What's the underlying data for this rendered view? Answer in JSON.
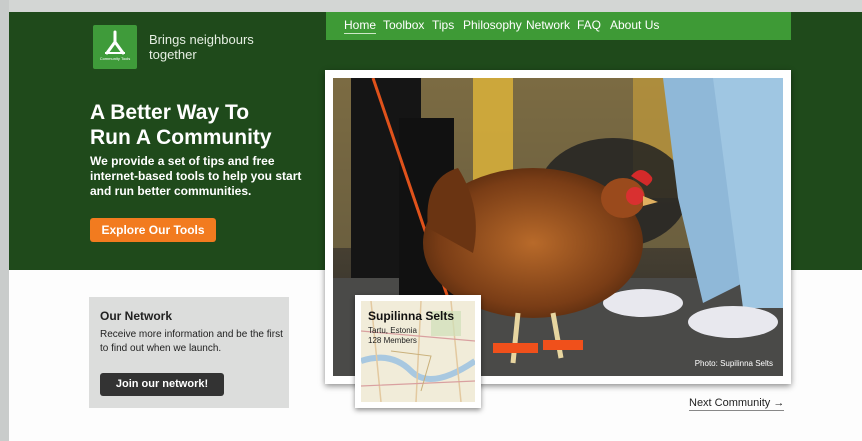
{
  "brand": {
    "logo_text": "Community Tools",
    "tagline_line1": "Brings neighbours",
    "tagline_line2": "together"
  },
  "nav": {
    "items": [
      "Home",
      "Toolbox",
      "Tips",
      "Philosophy",
      "Network",
      "FAQ",
      "About Us"
    ]
  },
  "hero": {
    "headline_line1": "A Better Way To",
    "headline_line2": "Run A Community",
    "lead": "We provide a set of tips and free internet-based tools to help you start and run better communities.",
    "cta_label": "Explore Our Tools"
  },
  "network": {
    "title": "Our Network",
    "text": "Receive more information and be the first to find out when we launch.",
    "button_label": "Join our network!"
  },
  "featured": {
    "photo_credit": "Photo: Supilinna Selts",
    "community_name": "Supilinna Selts",
    "location": "Tartu, Estonia",
    "members": "128 Members",
    "next_label": "Next Community →"
  },
  "colors": {
    "hero_green": "#1f4a1b",
    "nav_green": "#3e9a36",
    "cta_orange": "#f27b1f",
    "button_dark": "#333333"
  }
}
